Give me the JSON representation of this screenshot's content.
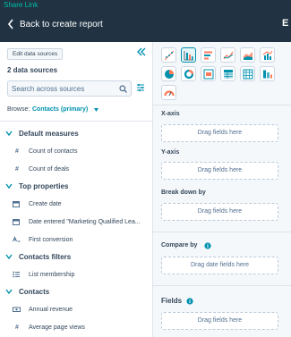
{
  "header": {
    "share_link": "Share Link",
    "back_label": "Back to create report",
    "right_letter": "E"
  },
  "sidebar": {
    "edit_label": "Edit data sources",
    "sources_count": "2 data sources",
    "search_placeholder": "Search across sources",
    "browse_label": "Browse:",
    "browse_value": "Contacts (primary)",
    "groups": [
      {
        "label": "Default measures",
        "items": [
          {
            "label": "Count of contacts",
            "icon": "#"
          },
          {
            "label": "Count of deals",
            "icon": "#"
          }
        ]
      },
      {
        "label": "Top properties",
        "items": [
          {
            "label": "Create date",
            "icon": "calendar-icon"
          },
          {
            "label": "Date entered \"Marketing Qualified Lea...",
            "icon": "calendar-icon"
          },
          {
            "label": "First conversion",
            "icon": "text-field-icon"
          }
        ]
      },
      {
        "label": "Contacts filters",
        "items": [
          {
            "label": "List membership",
            "icon": "list-icon"
          }
        ]
      },
      {
        "label": "Contacts",
        "items": [
          {
            "label": "Annual revenue",
            "icon": "currency-icon"
          },
          {
            "label": "Average page views",
            "icon": "#"
          }
        ]
      }
    ]
  },
  "chart_types": [
    "scatter-chart-icon",
    "bar-chart-icon",
    "horizontal-bar-chart-icon",
    "line-chart-icon",
    "area-chart-icon",
    "combo-chart-icon",
    "pie-chart-icon",
    "donut-chart-icon",
    "summary-chart-icon",
    "table-chart-icon",
    "pivot-table-icon",
    "funnel-chart-icon",
    "gauge-chart-icon"
  ],
  "config": {
    "xaxis_label": "X-axis",
    "yaxis_label": "Y-axis",
    "breakdown_label": "Break down by",
    "compare_label": "Compare by",
    "fields_label": "Fields",
    "drag_fields": "Drag fields here",
    "drag_date_fields": "Drag date fields here"
  },
  "colors": {
    "topbar": "#213343",
    "accent": "#0091ae",
    "chart_orange": "#ff7a59",
    "share_link": "#00bda5"
  }
}
